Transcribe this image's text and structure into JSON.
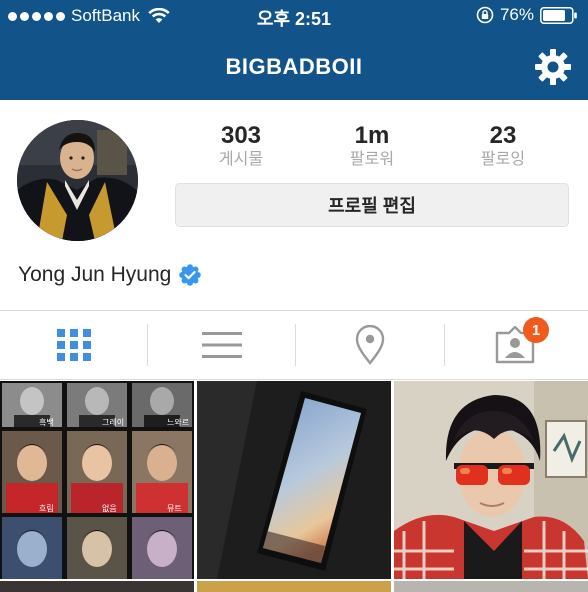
{
  "status_bar": {
    "carrier": "SoftBank",
    "time": "오후 2:51",
    "battery": "76%"
  },
  "nav": {
    "title": "BIGBADBOII",
    "settings_icon": "gear-icon"
  },
  "profile": {
    "stats": [
      {
        "value": "303",
        "label": "게시물"
      },
      {
        "value": "1m",
        "label": "팔로워"
      },
      {
        "value": "23",
        "label": "팔로잉"
      }
    ],
    "edit_label": "프로필 편집",
    "display_name": "Yong Jun Hyung",
    "verified_icon": "verified-badge-icon"
  },
  "tabs": {
    "items": [
      {
        "icon": "grid-icon",
        "active": true
      },
      {
        "icon": "list-icon",
        "active": false
      },
      {
        "icon": "location-pin-icon",
        "active": false
      },
      {
        "icon": "tagged-photos-icon",
        "active": false,
        "badge": "1"
      }
    ]
  },
  "grid": {
    "collage_captions": [
      "흑백",
      "그레이",
      "느와르",
      "흐림",
      "없음",
      "뮤트"
    ]
  },
  "colors": {
    "header_bg": "#12548a",
    "active_tab": "#3f8fde",
    "inactive_tab": "#999999",
    "badge": "#f05a1c",
    "verified": "#3897f0"
  }
}
